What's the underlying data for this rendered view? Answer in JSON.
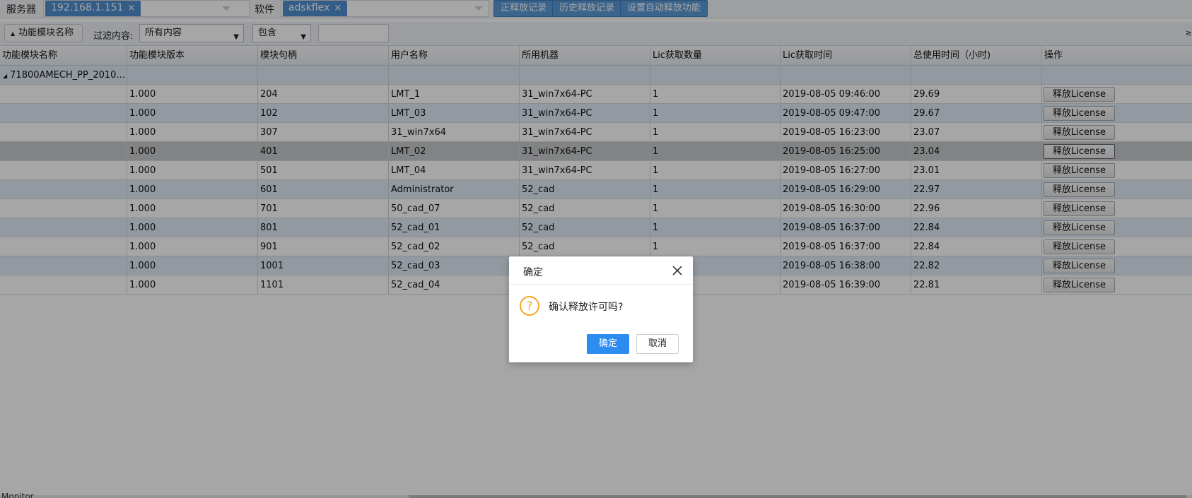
{
  "topbar": {
    "server_label": "服务器",
    "server_tag": "192.168.1.151",
    "software_label": "软件",
    "software_tag": "adskflex",
    "tag_close": "×",
    "buttons": [
      "正释放记录",
      "历史释放记录",
      "设置自动释放功能"
    ]
  },
  "filterbar": {
    "group_button": "功能模块名称",
    "filter_label": "过滤内容:",
    "filter_select": "所有内容",
    "match_select": "包含",
    "search_value": "",
    "edge_glyph": "≥"
  },
  "table": {
    "columns": [
      "功能模块名称",
      "功能模块版本",
      "模块句柄",
      "用户名称",
      "所用机器",
      "Lic获取数量",
      "Lic获取时间",
      "总使用时间（小时)",
      "操作"
    ],
    "group_row": "71800AMECH_PP_2010...",
    "release_label": "释放License",
    "rows": [
      {
        "version": "1.000",
        "handle": "204",
        "user": "LMT_1",
        "machine": "31_win7x64-PC",
        "count": "1",
        "time": "2019-08-05 09:46:00",
        "hours": "29.69"
      },
      {
        "version": "1.000",
        "handle": "102",
        "user": "LMT_03",
        "machine": "31_win7x64-PC",
        "count": "1",
        "time": "2019-08-05 09:47:00",
        "hours": "29.67"
      },
      {
        "version": "1.000",
        "handle": "307",
        "user": "31_win7x64",
        "machine": "31_win7x64-PC",
        "count": "1",
        "time": "2019-08-05 16:23:00",
        "hours": "23.07"
      },
      {
        "version": "1.000",
        "handle": "401",
        "user": "LMT_02",
        "machine": "31_win7x64-PC",
        "count": "1",
        "time": "2019-08-05 16:25:00",
        "hours": "23.04"
      },
      {
        "version": "1.000",
        "handle": "501",
        "user": "LMT_04",
        "machine": "31_win7x64-PC",
        "count": "1",
        "time": "2019-08-05 16:27:00",
        "hours": "23.01"
      },
      {
        "version": "1.000",
        "handle": "601",
        "user": "Administrator",
        "machine": "52_cad",
        "count": "1",
        "time": "2019-08-05 16:29:00",
        "hours": "22.97"
      },
      {
        "version": "1.000",
        "handle": "701",
        "user": "50_cad_07",
        "machine": "52_cad",
        "count": "1",
        "time": "2019-08-05 16:30:00",
        "hours": "22.96"
      },
      {
        "version": "1.000",
        "handle": "801",
        "user": "52_cad_01",
        "machine": "52_cad",
        "count": "1",
        "time": "2019-08-05 16:37:00",
        "hours": "22.84"
      },
      {
        "version": "1.000",
        "handle": "901",
        "user": "52_cad_02",
        "machine": "52_cad",
        "count": "1",
        "time": "2019-08-05 16:37:00",
        "hours": "22.84"
      },
      {
        "version": "1.000",
        "handle": "1001",
        "user": "52_cad_03",
        "machine": "",
        "count": "",
        "time": "2019-08-05 16:38:00",
        "hours": "22.82"
      },
      {
        "version": "1.000",
        "handle": "1101",
        "user": "52_cad_04",
        "machine": "",
        "count": "",
        "time": "2019-08-05 16:39:00",
        "hours": "22.81"
      }
    ]
  },
  "bottom_text": "Monitor",
  "dialog": {
    "title": "确定",
    "message": "确认释放许可吗?",
    "ok": "确定",
    "cancel": "取消",
    "icon": "question-icon",
    "icon_color": "#f5a623"
  },
  "colors": {
    "accent": "#2d8cf0",
    "tag_blue": "#4f8fd0",
    "row_alt": "#e2ecf8"
  }
}
